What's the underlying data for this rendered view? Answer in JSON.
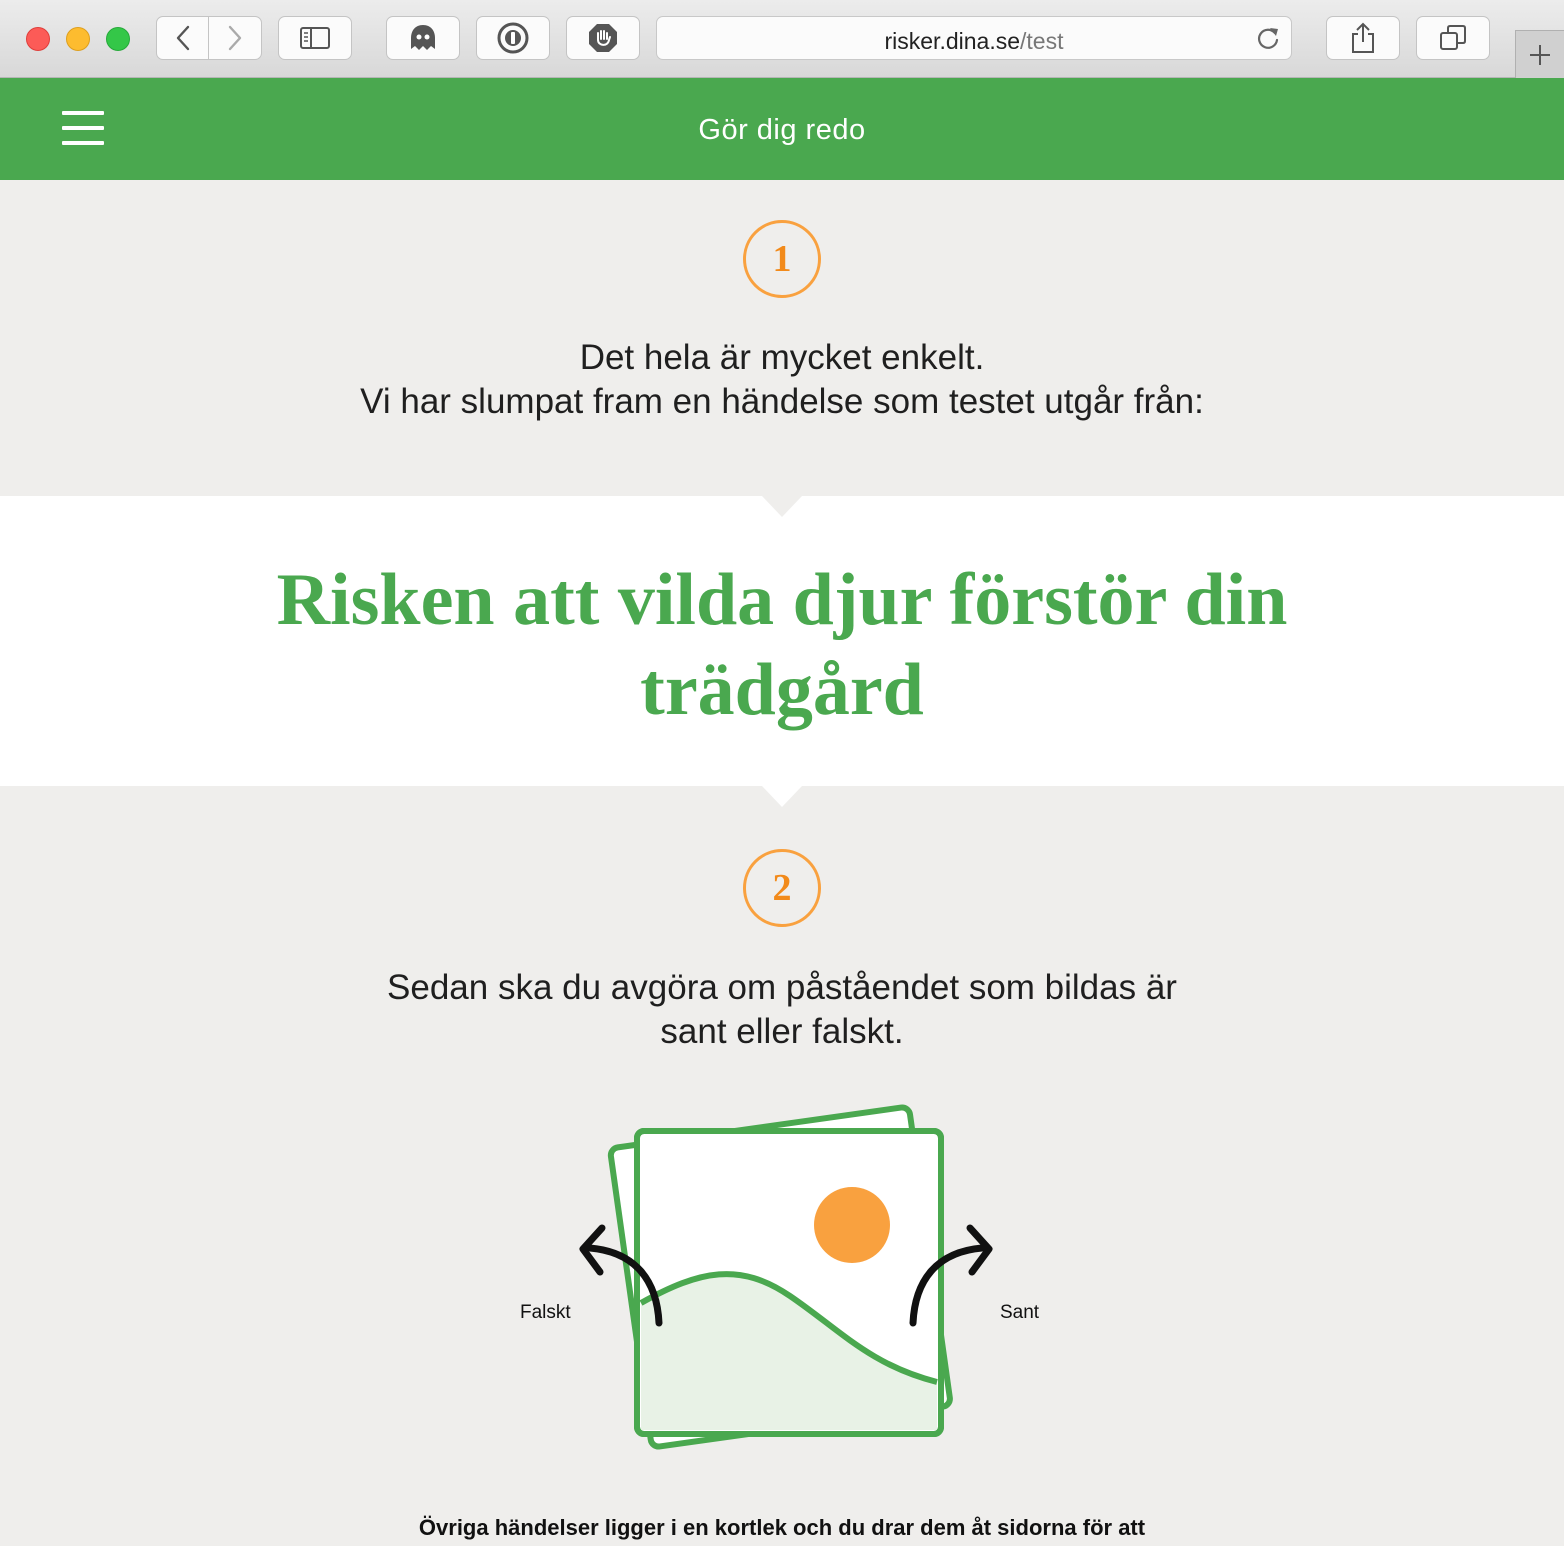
{
  "browser": {
    "url_host": "risker.dina.se",
    "url_path": "/test"
  },
  "header": {
    "title": "Gör dig redo"
  },
  "step1": {
    "number": "1",
    "line1": "Det hela är mycket enkelt.",
    "line2": "Vi har slumpat fram en händelse som testet utgår från:"
  },
  "event_card": {
    "line1": "Risken att vilda djur förstör din",
    "line2": "trädgård"
  },
  "step2": {
    "number": "2",
    "line1": "Sedan ska du avgöra om påståendet som bildas är",
    "line2": "sant eller falskt."
  },
  "illustration": {
    "left_label": "Falskt",
    "right_label": "Sant",
    "card_color": "#4aa84f",
    "sun_color": "#f9a13f"
  },
  "footer_text": "Övriga händelser ligger i en kortlek och du drar dem åt sidorna för att"
}
